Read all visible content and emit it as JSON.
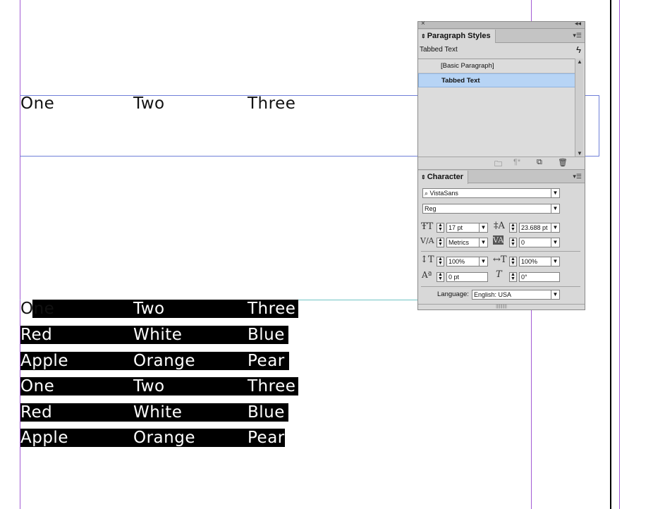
{
  "document": {
    "header_row": [
      "One",
      "Two",
      "Three"
    ],
    "rows": [
      [
        "One",
        "Two",
        "Three"
      ],
      [
        "Red",
        "White",
        "Blue"
      ],
      [
        "Apple",
        "Orange",
        "Pear"
      ],
      [
        "One",
        "Two",
        "Three"
      ],
      [
        "Red",
        "White",
        "Blue"
      ],
      [
        "Apple",
        "Orange",
        "Pear"
      ]
    ]
  },
  "colors": {
    "guide_purple": "#a35bd4",
    "guide_blue": "#6f7fd8",
    "selection_bg": "#000000",
    "list_selected": "#b7d4f5"
  },
  "paragraph_styles": {
    "title": "Paragraph Styles",
    "current_style": "Tabbed Text",
    "items": [
      {
        "label": "[Basic Paragraph]"
      },
      {
        "label": "Tabbed Text"
      }
    ]
  },
  "character": {
    "title": "Character",
    "font_family": "VistaSans",
    "font_style": "Reg",
    "font_size": "17 pt",
    "leading": "23.688 pt",
    "kerning": "Metrics",
    "tracking": "0",
    "vertical_scale": "100%",
    "horizontal_scale": "100%",
    "baseline_shift": "0 pt",
    "skew": "0°",
    "language_label": "Language:",
    "language": "English: USA"
  }
}
